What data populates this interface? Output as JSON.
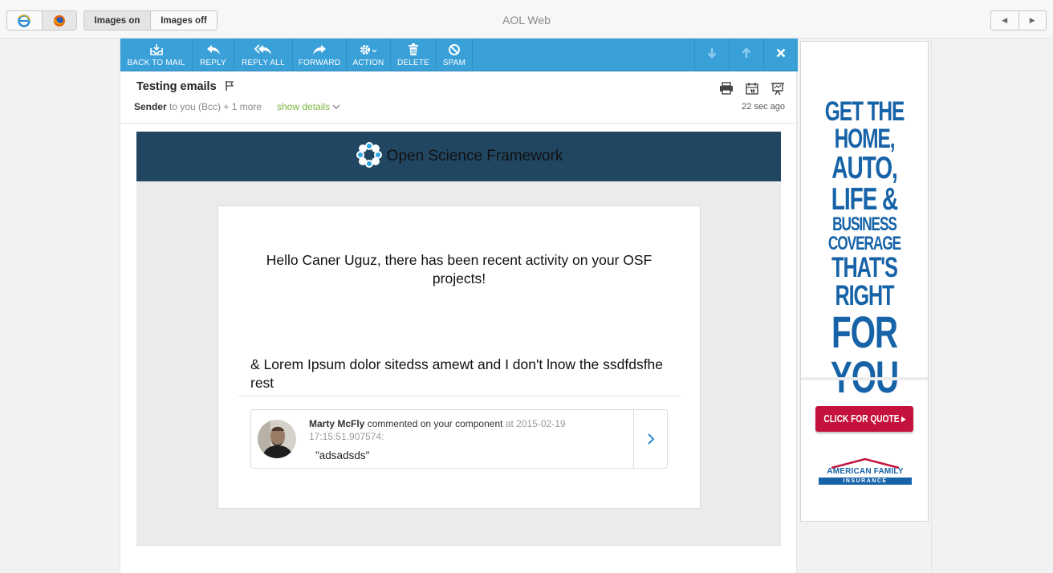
{
  "window": {
    "title": "AOL Web"
  },
  "browser_switch": [
    {
      "name": "internet-explorer-icon"
    },
    {
      "name": "firefox-icon"
    }
  ],
  "images_toggle": {
    "on": "Images on",
    "off": "Images off"
  },
  "toolbar": {
    "back": "BACK TO MAIL",
    "reply": "REPLY",
    "reply_all": "REPLY ALL",
    "forward": "FORWARD",
    "action": "ACTION",
    "delete": "DELETE",
    "spam": "SPAM"
  },
  "message": {
    "subject": "Testing emails",
    "sender": "Sender",
    "recipients": "to you (Bcc) + 1 more",
    "show_details": "show details",
    "time": "22 sec ago"
  },
  "email": {
    "brand": "Open Science Framework",
    "greeting": "Hello Caner Uguz, there has been recent activity on your OSF projects!",
    "lorem": "& Lorem Ipsum dolor sitedss amewt and I don't lnow the ssdfdsfhe rest",
    "comment": {
      "author": "Marty McFly",
      "verb": "commented on your component",
      "at": "at 2015-02-19 17:15:51.907574:",
      "quote": "\"adsadsds\""
    }
  },
  "ad": {
    "line1": "GET THE HOME,",
    "line2": "AUTO, LIFE &",
    "line3": "BUSINESS COVERAGE",
    "line4": "THAT'S RIGHT",
    "line5": "FOR YOU",
    "cta": "CLICK FOR QUOTE ▸",
    "logo_line1": "AMERICAN FAMILY",
    "logo_line2": "INSURANCE"
  },
  "colors": {
    "toolbar": "#3aa0d8",
    "osf_header": "#214661",
    "ad_blue": "#1763a8",
    "ad_red": "#c4123c",
    "link_green": "#7cb342"
  }
}
